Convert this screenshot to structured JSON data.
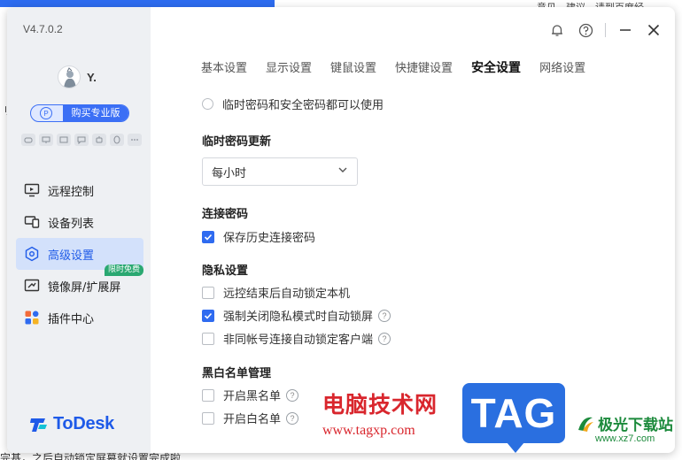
{
  "background": {
    "top_link": "意见，建议，请到百度经",
    "left_text": "刂",
    "bottom_text": "完基，之后自动锁定屏幕就设置完成啦"
  },
  "app": {
    "version": "V4.7.0.2",
    "user": {
      "name": "Y."
    },
    "buy_pro_label": "购买专业版",
    "feature_icons": [
      "gamepad-icon",
      "monitor-icon",
      "card-icon",
      "chat-icon",
      "robot-icon",
      "penguin-icon",
      "more-icon"
    ],
    "nav": [
      {
        "label": "远程控制",
        "icon": "remote-control-icon",
        "active": false
      },
      {
        "label": "设备列表",
        "icon": "device-list-icon",
        "active": false
      },
      {
        "label": "高级设置",
        "icon": "advanced-settings-icon",
        "active": true
      },
      {
        "label": "镜像屏/扩展屏",
        "icon": "mirror-screen-icon",
        "active": false,
        "badge": "限时免费"
      },
      {
        "label": "插件中心",
        "icon": "plugin-center-icon",
        "active": false
      }
    ],
    "logo_text": "ToDesk"
  },
  "tabs": [
    {
      "label": "基本设置",
      "active": false
    },
    {
      "label": "显示设置",
      "active": false
    },
    {
      "label": "键鼠设置",
      "active": false
    },
    {
      "label": "快捷键设置",
      "active": false
    },
    {
      "label": "安全设置",
      "active": true
    },
    {
      "label": "网络设置",
      "active": false
    }
  ],
  "security": {
    "radio_option": "临时密码和安全密码都可以使用",
    "temp_password_update": {
      "title": "临时密码更新",
      "selected": "每小时"
    },
    "connection_password": {
      "title": "连接密码",
      "save_history": {
        "label": "保存历史连接密码",
        "checked": true
      }
    },
    "privacy": {
      "title": "隐私设置",
      "options": [
        {
          "label": "远控结束后自动锁定本机",
          "checked": false,
          "help": false
        },
        {
          "label": "强制关闭隐私模式时自动锁屏",
          "checked": true,
          "help": true
        },
        {
          "label": "非同帐号连接自动锁定客户端",
          "checked": false,
          "help": true
        }
      ]
    },
    "blackwhite": {
      "title": "黑白名单管理",
      "options": [
        {
          "label": "开启黑名单",
          "checked": false,
          "help": true
        },
        {
          "label": "开启白名单",
          "checked": false,
          "help": true
        }
      ]
    }
  },
  "watermark": {
    "red_text": "电脑技术网",
    "url": "www.tagxp.com",
    "tag": "TAG",
    "site_name": "极光下载站",
    "site_url": "www.xz7.com"
  },
  "colors": {
    "accent": "#2f6bf0",
    "sidebar_bg": "#eef0f3",
    "active_nav_bg": "#d3e1fb",
    "badge_green": "#2aa871"
  }
}
